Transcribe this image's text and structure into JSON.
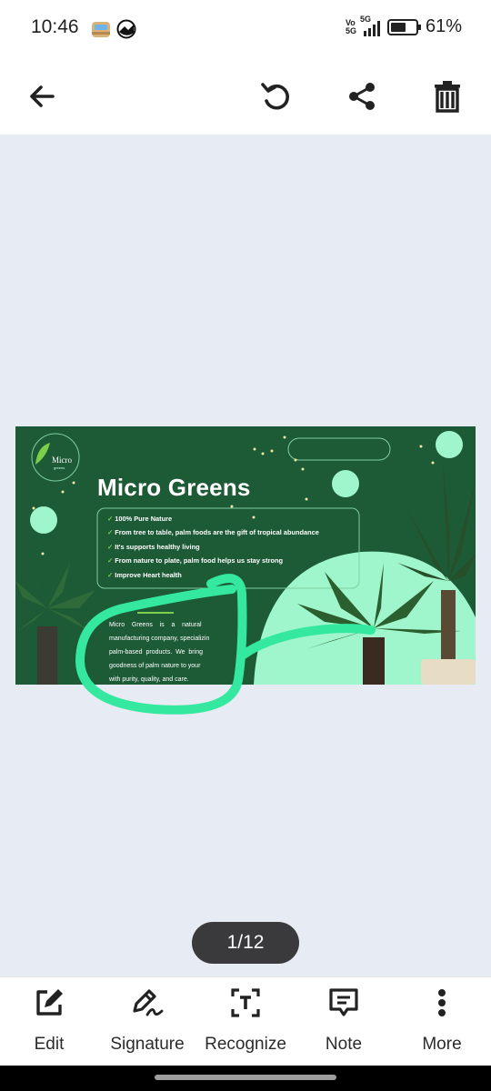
{
  "status_bar": {
    "time": "10:46",
    "network": "5G",
    "volte_top": "Vo",
    "volte_bottom": "5G",
    "battery": "61%",
    "battery_level": 0.61
  },
  "toolbar": {
    "back_icon": "arrow-left-icon",
    "rotate_icon": "rotate-icon",
    "share_icon": "share-icon",
    "delete_icon": "trash-icon"
  },
  "document": {
    "title": "Micro Greens",
    "logo_text": "Micro",
    "logo_sub": "greens",
    "bullets": [
      "100% Pure Nature",
      "From tree to table, palm foods are the gift of tropical abundance",
      "It's  supports healthy living",
      "From nature to plate, palm food helps us stay strong",
      "Improve Heart health"
    ],
    "paragraph_lines": [
      "Micro    Greens    is    a    natural",
      "manufacturing company, specializin",
      "palm-based  products.  We  bring",
      "goodness of palm nature to your",
      "with purity, quality, and care."
    ]
  },
  "page_indicator": "1/12",
  "bottom_bar": {
    "items": [
      {
        "label": "Edit",
        "icon": "edit-icon"
      },
      {
        "label": "Signature",
        "icon": "signature-icon"
      },
      {
        "label": "Recognize",
        "icon": "recognize-text-icon"
      },
      {
        "label": "Note",
        "icon": "note-icon"
      },
      {
        "label": "More",
        "icon": "more-vertical-icon"
      }
    ]
  },
  "colors": {
    "banner_green": "#1d5a36",
    "mint": "#9ff5cc",
    "annotation_stroke": "#35e8a0",
    "pill": "#3a3a3c"
  }
}
